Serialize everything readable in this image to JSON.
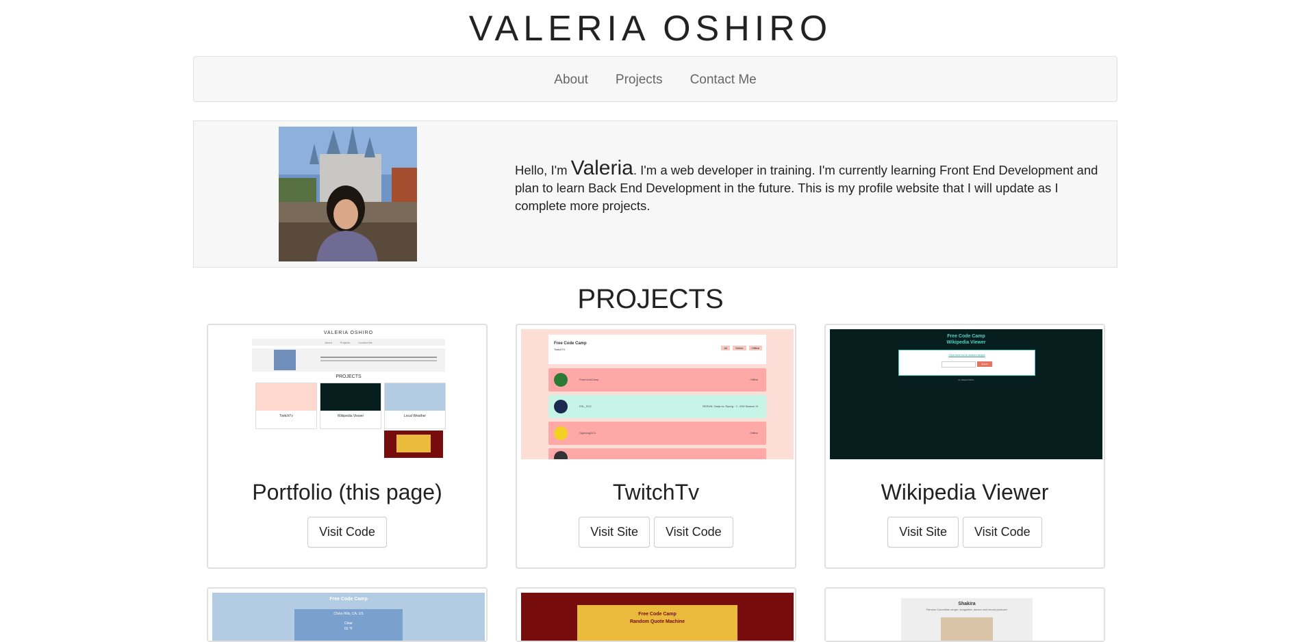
{
  "site_title": "VALERIA OSHIRO",
  "nav": {
    "items": [
      {
        "label": "About"
      },
      {
        "label": "Projects"
      },
      {
        "label": "Contact Me"
      }
    ]
  },
  "about": {
    "greeting": "Hello, I'm ",
    "name": "Valeria",
    "text": ". I'm a web developer in training. I'm currently learning Front End Development and plan to learn Back End Development in the future. This is my profile website that I will update as I complete more projects."
  },
  "projects": {
    "heading": "PROJECTS",
    "cards": [
      {
        "title": "Portfolio (this page)",
        "code_label": "Visit Code"
      },
      {
        "title": "TwitchTv",
        "site_label": "Visit Site",
        "code_label": "Visit Code"
      },
      {
        "title": "Wikipedia Viewer",
        "site_label": "Visit Site",
        "code_label": "Visit Code"
      }
    ]
  },
  "thumbnails": {
    "portfolio": {
      "title": "VALERIA OSHIRO",
      "heading": "PROJECTS",
      "nav": [
        "About",
        "Projects",
        "Contact Me"
      ],
      "card1": "TwitchTv",
      "card2": "Wikipedia Viewer",
      "card3": "Local Weather"
    },
    "twitch": {
      "title": "Free Code Camp",
      "subtitle": "TwitchTV",
      "tabs": [
        "All",
        "Online",
        "Offline"
      ],
      "rows": [
        {
          "name": "FreeCodeCamp",
          "status": "Offline"
        },
        {
          "name": "ESL_SC2",
          "status": "RERUN: Taeja vs. Ryung · 2 - IEM Season XI"
        },
        {
          "name": "OgamingSC2",
          "status": "Offline"
        }
      ]
    },
    "wiki": {
      "title": "Free Code Camp",
      "subtitle": "Wikipedia Viewer",
      "link": "Click here for a random article",
      "button": "Search",
      "footer": "by Valeria Oshiro"
    },
    "weather": {
      "title": "Free Code Camp",
      "location": "Chino Hills, CA, US",
      "condition": "Clear",
      "temp": "65 °F"
    },
    "quote": {
      "title": "Free Code Camp",
      "subtitle": "Random Quote Machine"
    },
    "tribute": {
      "name": "Shakira",
      "desc": "Famous Colombian singer, songwriter, dancer and record producer"
    }
  },
  "colors": {
    "panel_bg": "#f7f7f7",
    "border": "#e0e0e0",
    "nav_text": "#666666",
    "wiki_bg": "#071e1e",
    "wiki_title": "#4fd1c5",
    "twitch_pink": "#ffa8a8",
    "twitch_mint": "#c6f5e8",
    "quote_red": "#760c0c",
    "quote_yellow": "#eaba3c",
    "weather_blue": "#b3cce4"
  }
}
